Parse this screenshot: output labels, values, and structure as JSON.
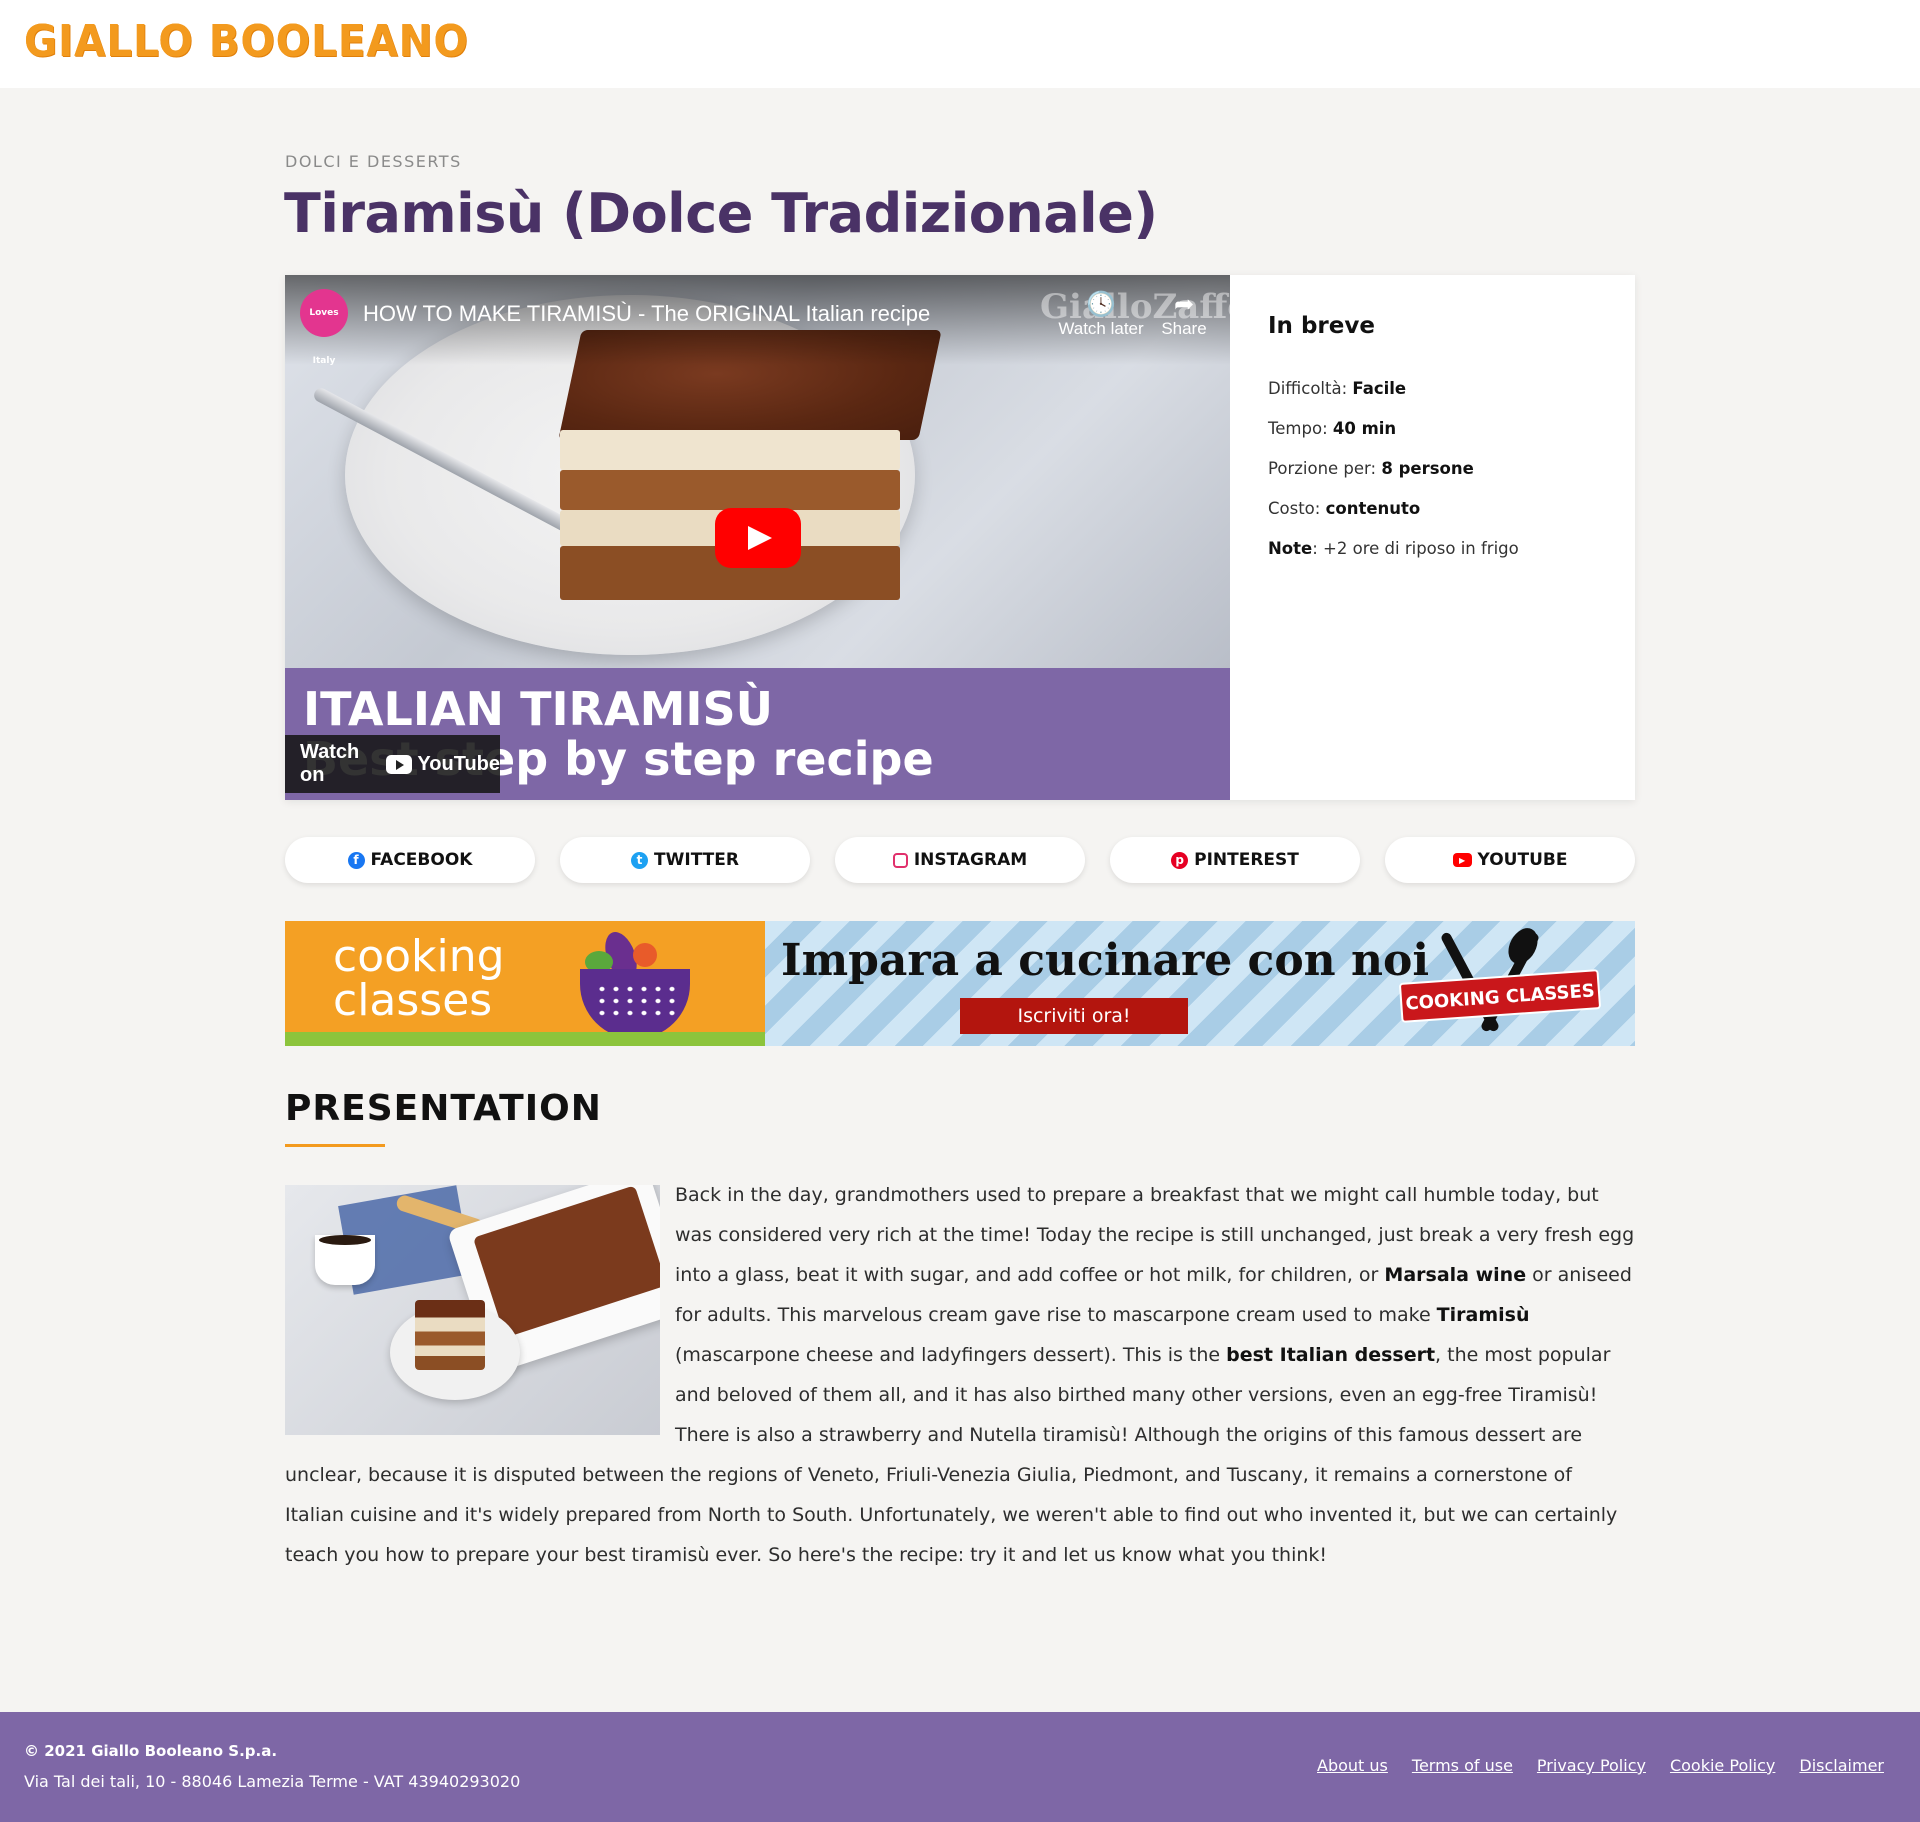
{
  "header": {
    "logo_text": "GIALLO BOOLEANO"
  },
  "article": {
    "category": "DOLCI E DESSERTS",
    "title": "Tiramisù (Dolce Tradizionale)"
  },
  "video": {
    "channel_avatar": "Loves Italy",
    "title": "HOW TO MAKE TIRAMISÙ - The ORIGINAL Italian recipe",
    "watch_later": "Watch later",
    "share": "Share",
    "watermark": "GialloZafferano",
    "banner_line1": "ITALIAN TIRAMISÙ",
    "banner_line2": "Best step by step recipe",
    "watch_on": "Watch on",
    "youtube_label": "YouTube",
    "icons": [
      "clock-icon",
      "share-icon",
      "play-icon",
      "youtube-icon"
    ]
  },
  "info": {
    "heading": "In breve",
    "rows": [
      {
        "label": "Difficoltà: ",
        "value": "Facile"
      },
      {
        "label": "Tempo: ",
        "value": "40 min"
      },
      {
        "label": "Porzione per: ",
        "value": "8 persone"
      },
      {
        "label": "Costo: ",
        "value": "contenuto"
      },
      {
        "label": "Note",
        "value": ": +2 ore di riposo in frigo"
      }
    ]
  },
  "social": [
    {
      "label": "FACEBOOK",
      "icon": "facebook-icon",
      "color": "#1877f2"
    },
    {
      "label": "TWITTER",
      "icon": "twitter-icon",
      "color": "#1da1f2"
    },
    {
      "label": "INSTAGRAM",
      "icon": "instagram-icon",
      "color": "#e1306c"
    },
    {
      "label": "PINTEREST",
      "icon": "pinterest-icon",
      "color": "#e60023"
    },
    {
      "label": "YOUTUBE",
      "icon": "youtube-icon",
      "color": "#ff0000"
    }
  ],
  "ad": {
    "left_line1": "cooking",
    "left_line2": "classes",
    "headline": "Impara a cucinare con noi",
    "cta": "Iscriviti ora!",
    "ribbon": "COOKING CLASSES"
  },
  "presentation": {
    "heading": "PRESENTATION",
    "p1": "Back in the day, grandmothers used to prepare a breakfast that we might call humble today, but was considered very rich at the time! Today the recipe is still unchanged, just break a very fresh egg into a glass, beat it with sugar, and add coffee or hot milk, for children, or ",
    "b1": "Marsala wine",
    "p2": " or aniseed for adults. This marvelous cream gave rise to mascarpone cream used to make ",
    "b2": "Tiramisù",
    "p3": " (mascarpone cheese and ladyfingers dessert). This is the ",
    "b3": "best Italian dessert",
    "p4": ", the most popular and beloved of them all, and it has also birthed many other versions, even an egg-free Tiramisù! There is also a strawberry and Nutella tiramisù! Although the origins of this famous dessert are unclear, because it is disputed between the regions of Veneto, Friuli-Venezia Giulia, Piedmont, and Tuscany, it remains a cornerstone of Italian cuisine and it's widely prepared from North to South. Unfortunately, we weren't able to find out who invented it, but we can certainly teach you how to prepare your best tiramisù ever. So here's the recipe: try it and let us know what you think!"
  },
  "footer": {
    "copyright": "© 2021 Giallo Booleano S.p.a.",
    "address": "Via Tal dei tali, 10 - 88046 Lamezia Terme - VAT 43940293020",
    "links": [
      "About us",
      "Terms of use",
      "Privacy Policy",
      "Cookie Policy",
      "Disclaimer"
    ]
  },
  "colors": {
    "brand_orange": "#f39a1e",
    "title_purple": "#4a3266",
    "footer_purple": "#7e67a6"
  }
}
